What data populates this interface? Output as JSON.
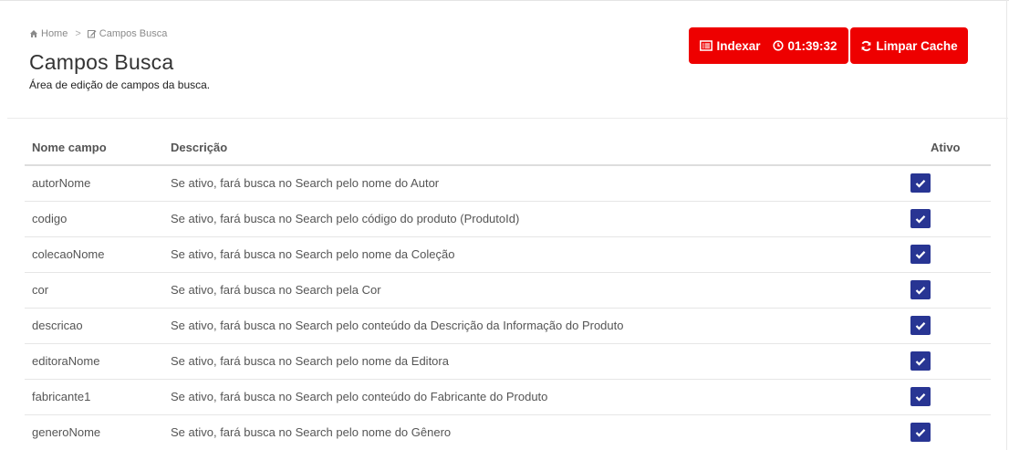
{
  "breadcrumb": {
    "home_label": "Home",
    "separator": ">",
    "current_label": "Campos Busca"
  },
  "page": {
    "title": "Campos Busca",
    "subtitle": "Área de edição de campos da busca."
  },
  "toolbar": {
    "index_label": "Indexar",
    "timer_value": "01:39:32",
    "cache_label": "Limpar Cache"
  },
  "colors": {
    "button_red": "#ee0000",
    "checkbox_blue": "#283593"
  },
  "table": {
    "headers": {
      "name": "Nome campo",
      "description": "Descrição",
      "active": "Ativo"
    },
    "rows": [
      {
        "name": "autorNome",
        "description": "Se ativo, fará busca no Search pelo nome do Autor",
        "active": true
      },
      {
        "name": "codigo",
        "description": "Se ativo, fará busca no Search pelo código do produto (ProdutoId)",
        "active": true
      },
      {
        "name": "colecaoNome",
        "description": "Se ativo, fará busca no Search pelo nome da Coleção",
        "active": true
      },
      {
        "name": "cor",
        "description": "Se ativo, fará busca no Search pela Cor",
        "active": true
      },
      {
        "name": "descricao",
        "description": "Se ativo, fará busca no Search pelo conteúdo da Descrição da Informação do Produto",
        "active": true
      },
      {
        "name": "editoraNome",
        "description": "Se ativo, fará busca no Search pelo nome da Editora",
        "active": true
      },
      {
        "name": "fabricante1",
        "description": "Se ativo, fará busca no Search pelo conteúdo do Fabricante do Produto",
        "active": true
      },
      {
        "name": "generoNome",
        "description": "Se ativo, fará busca no Search pelo nome do Gênero",
        "active": true
      }
    ]
  }
}
